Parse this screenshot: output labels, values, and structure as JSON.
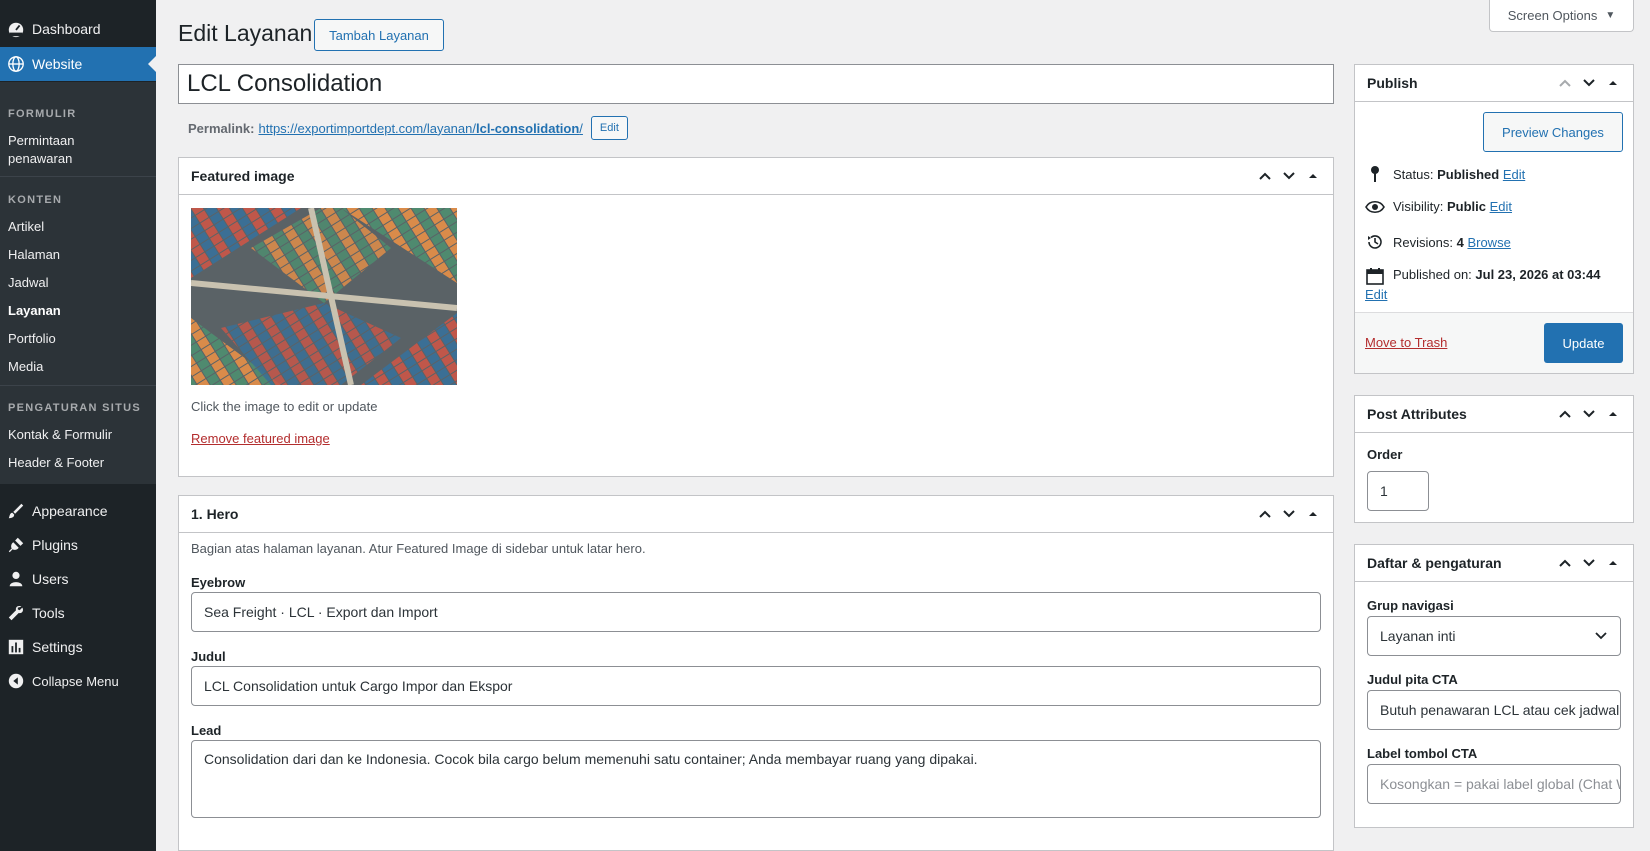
{
  "menu": {
    "dashboard": "Dashboard",
    "website": "Website",
    "sections": [
      {
        "heading": "FORMULIR",
        "items": [
          "Permintaan penawaran"
        ]
      },
      {
        "heading": "KONTEN",
        "items": [
          "Artikel",
          "Halaman",
          "Jadwal",
          "Layanan",
          "Portfolio",
          "Media"
        ]
      },
      {
        "heading": "PENGATURAN SITUS",
        "items": [
          "Kontak & Formulir",
          "Header & Footer"
        ]
      }
    ],
    "permintaan_line1": "Permintaan",
    "permintaan_line2": "penawaran",
    "active_item": "Layanan",
    "appearance": "Appearance",
    "plugins": "Plugins",
    "users": "Users",
    "tools": "Tools",
    "settings": "Settings",
    "collapse": "Collapse Menu"
  },
  "header": {
    "screen_options": "Screen Options",
    "page_title": "Edit Layanan",
    "add_new": "Tambah Layanan"
  },
  "post": {
    "title": "LCL Consolidation",
    "permalink_label": "Permalink:",
    "permalink_base": "https://exportimportdept.com/layanan/",
    "permalink_slug": "lcl-consolidation",
    "permalink_trail": "/",
    "permalink_edit": "Edit"
  },
  "featured": {
    "title": "Featured image",
    "help": "Click the image to edit or update",
    "remove": "Remove featured image"
  },
  "hero": {
    "title": "1. Hero",
    "description": "Bagian atas halaman layanan. Atur Featured Image di sidebar untuk latar hero.",
    "eyebrow_label": "Eyebrow",
    "eyebrow_value": "Sea Freight · LCL · Export dan Import",
    "judul_label": "Judul",
    "judul_value": "LCL Consolidation untuk Cargo Impor dan Ekspor",
    "lead_label": "Lead",
    "lead_value": "Consolidation dari dan ke Indonesia. Cocok bila cargo belum memenuhi satu container; Anda membayar ruang yang dipakai."
  },
  "publish": {
    "title": "Publish",
    "preview": "Preview Changes",
    "status_label": "Status:",
    "status_value": "Published",
    "visibility_label": "Visibility:",
    "visibility_value": "Public",
    "revisions_label": "Revisions:",
    "revisions_value": "4",
    "browse": "Browse",
    "published_label": "Published on:",
    "published_value": "Jul 23, 2026 at 03:44",
    "edit": "Edit",
    "trash": "Move to Trash",
    "update": "Update"
  },
  "attributes": {
    "title": "Post Attributes",
    "order_label": "Order",
    "order_value": "1"
  },
  "daftar": {
    "title": "Daftar & pengaturan",
    "grup_label": "Grup navigasi",
    "grup_value": "Layanan inti",
    "cta_title_label": "Judul pita CTA",
    "cta_title_value": "Butuh penawaran LCL atau cek jadwal?",
    "cta_button_label": "Label tombol CTA",
    "cta_button_placeholder": "Kosongkan = pakai label global (Chat WhatsApp)"
  },
  "colors": {
    "admin_bg": "#1d2327",
    "submenu_bg": "#2c3338",
    "accent": "#2271b1",
    "danger": "#b32d2e"
  },
  "icons": [
    "dashboard-icon",
    "globe-icon",
    "brush-icon",
    "plugin-icon",
    "user-icon",
    "wrench-icon",
    "settings-icon",
    "collapse-icon",
    "pin-icon",
    "eye-icon",
    "history-icon",
    "calendar-icon",
    "chevron-up-icon",
    "chevron-down-icon",
    "triangle-up-icon"
  ]
}
